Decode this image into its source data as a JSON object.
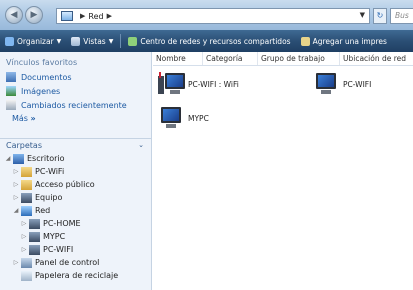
{
  "address": {
    "crumbs": [
      "Red"
    ],
    "search_placeholder": "Bus"
  },
  "toolbar": {
    "organize": "Organizar",
    "views": "Vistas",
    "network_center": "Centro de redes y recursos compartidos",
    "add_printer": "Agregar una impres"
  },
  "favorites": {
    "heading": "Vínculos favoritos",
    "items": [
      "Documentos",
      "Imágenes",
      "Cambiados recientemente"
    ],
    "more": "Más"
  },
  "folders": {
    "heading": "Carpetas",
    "tree": [
      {
        "label": "Escritorio",
        "level": 0,
        "expander": "open"
      },
      {
        "label": "PC-WiFi",
        "level": 1,
        "expander": "closed"
      },
      {
        "label": "Acceso público",
        "level": 1,
        "expander": "closed"
      },
      {
        "label": "Equipo",
        "level": 1,
        "expander": "closed"
      },
      {
        "label": "Red",
        "level": 1,
        "expander": "open",
        "selected": true
      },
      {
        "label": "PC-HOME",
        "level": 2,
        "expander": "closed"
      },
      {
        "label": "MYPC",
        "level": 2,
        "expander": "closed"
      },
      {
        "label": "PC-WIFI",
        "level": 2,
        "expander": "closed"
      },
      {
        "label": "Panel de control",
        "level": 1,
        "expander": "closed"
      },
      {
        "label": "Papelera de reciclaje",
        "level": 1,
        "expander": "none"
      }
    ]
  },
  "columns": [
    "Nombre",
    "Categoría",
    "Grupo de trabajo",
    "Ubicación de red"
  ],
  "items": [
    {
      "name": "PC-WIFI : WiFi",
      "icon": "media-device-icon"
    },
    {
      "name": "PC-WIFI",
      "icon": "computer-icon"
    },
    {
      "name": "MYPC",
      "icon": "computer-icon"
    }
  ]
}
